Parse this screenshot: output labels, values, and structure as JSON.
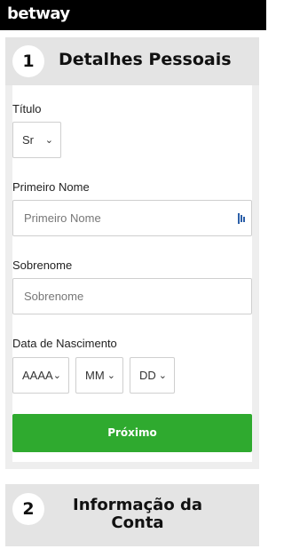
{
  "header": {
    "logo_text": "betway"
  },
  "step1": {
    "number": "1",
    "title": "Detalhes Pessoais",
    "title_label": "Título",
    "title_select_value": "Sr",
    "first_name_label": "Primeiro Nome",
    "first_name_placeholder": "Primeiro Nome",
    "surname_label": "Sobrenome",
    "surname_placeholder": "Sobrenome",
    "dob_label": "Data de Nascimento",
    "dob_year": "AAAA",
    "dob_month": "MM",
    "dob_day": "DD",
    "next_button": "Próximo"
  },
  "step2": {
    "number": "2",
    "title": "Informação da Conta"
  },
  "icons": {
    "chevron": "chevron-down-icon",
    "password_manager": "key-icon"
  },
  "colors": {
    "topbar": "#000000",
    "primary_button": "#2faa2f",
    "panel": "#eeeeee"
  }
}
